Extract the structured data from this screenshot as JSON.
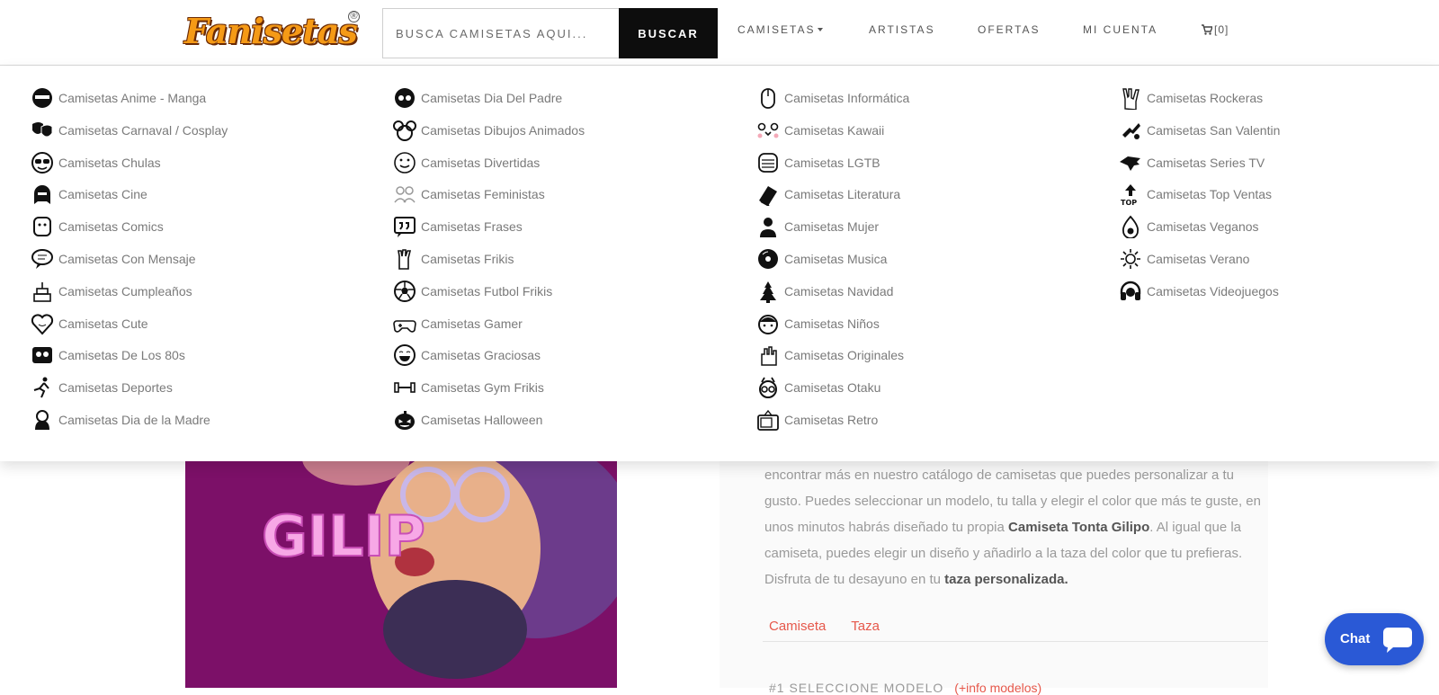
{
  "header": {
    "logo_text": "Fanisetas",
    "logo_mark": "®",
    "search_placeholder": "BUSCA CAMISETAS AQUI...",
    "search_button": "BUSCAR",
    "nav": [
      {
        "label": "CAMISETAS",
        "has_caret": true
      },
      {
        "label": "ARTISTAS"
      },
      {
        "label": "OFERTAS"
      },
      {
        "label": "MI CUENTA"
      }
    ],
    "cart_label": "[0]",
    "cart_icon": "cart-icon"
  },
  "menu": {
    "columns": [
      [
        {
          "label": "Camisetas Anime - Manga",
          "icon": "anime-icon"
        },
        {
          "label": "Camisetas Carnaval / Cosplay",
          "icon": "masks-icon"
        },
        {
          "label": "Camisetas Chulas",
          "icon": "sunglasses-face-icon"
        },
        {
          "label": "Camisetas Cine",
          "icon": "vader-icon"
        },
        {
          "label": "Camisetas Comics",
          "icon": "comic-face-icon"
        },
        {
          "label": "Camisetas Con Mensaje",
          "icon": "speech-bubble-icon"
        },
        {
          "label": "Camisetas Cumpleaños",
          "icon": "cake-icon"
        },
        {
          "label": "Camisetas Cute",
          "icon": "heart-face-icon"
        },
        {
          "label": "Camisetas De Los 80s",
          "icon": "cassette-icon"
        },
        {
          "label": "Camisetas Deportes",
          "icon": "runner-icon"
        },
        {
          "label": "Camisetas Dia de la Madre",
          "icon": "mother-icon"
        }
      ],
      [
        {
          "label": "Camisetas Dia Del Padre",
          "icon": "father-icon"
        },
        {
          "label": "Camisetas Dibujos Animados",
          "icon": "mouse-ears-icon"
        },
        {
          "label": "Camisetas Divertidas",
          "icon": "smiley-icon"
        },
        {
          "label": "Camisetas Feministas",
          "icon": "women-group-icon"
        },
        {
          "label": "Camisetas Frases",
          "icon": "quote-icon"
        },
        {
          "label": "Camisetas Frikis",
          "icon": "vulcan-hand-icon"
        },
        {
          "label": "Camisetas Futbol Frikis",
          "icon": "soccer-ball-icon"
        },
        {
          "label": "Camisetas Gamer",
          "icon": "gamepad-icon"
        },
        {
          "label": "Camisetas Graciosas",
          "icon": "laugh-icon"
        },
        {
          "label": "Camisetas Gym Frikis",
          "icon": "dumbbell-icon"
        },
        {
          "label": "Camisetas Halloween",
          "icon": "pumpkin-icon"
        }
      ],
      [
        {
          "label": "Camisetas Informática",
          "icon": "computer-mouse-icon"
        },
        {
          "label": "Camisetas Kawaii",
          "icon": "kawaii-face-icon"
        },
        {
          "label": "Camisetas LGTB",
          "icon": "rainbow-face-icon"
        },
        {
          "label": "Camisetas Literatura",
          "icon": "book-icon"
        },
        {
          "label": "Camisetas Mujer",
          "icon": "woman-icon"
        },
        {
          "label": "Camisetas Musica",
          "icon": "vinyl-icon"
        },
        {
          "label": "Camisetas Navidad",
          "icon": "christmas-tree-icon"
        },
        {
          "label": "Camisetas Niños",
          "icon": "child-face-icon"
        },
        {
          "label": "Camisetas Originales",
          "icon": "idea-hand-icon"
        },
        {
          "label": "Camisetas Otaku",
          "icon": "otaku-icon"
        },
        {
          "label": "Camisetas Retro",
          "icon": "tv-icon"
        }
      ],
      [
        {
          "label": "Camisetas Rockeras",
          "icon": "rock-hand-icon"
        },
        {
          "label": "Camisetas San Valentin",
          "icon": "cupid-icon"
        },
        {
          "label": "Camisetas Series TV",
          "icon": "wolf-icon"
        },
        {
          "label": "Camisetas Top Ventas",
          "icon": "top-icon"
        },
        {
          "label": "Camisetas Veganos",
          "icon": "avocado-icon"
        },
        {
          "label": "Camisetas Verano",
          "icon": "sun-icon"
        },
        {
          "label": "Camisetas Videojuegos",
          "icon": "headset-icon"
        }
      ]
    ]
  },
  "hero": {
    "art_text": "GILIP",
    "bg_color": "#7c1068"
  },
  "description": {
    "text_1": "encontrar más en nuestro catálogo de camisetas que puedes personalizar a tu gusto. Puedes seleccionar un modelo, tu talla y elegir el color que más te guste, en unos minutos habrás diseñado tu propia ",
    "bold_1": "Camiseta Tonta Gilipo",
    "text_2": ". Al igual que la camiseta, puedes elegir un diseño y añadirlo a la taza del color que tu prefieras. Disfruta de tu desayuno en tu ",
    "bold_2": "taza personalizada.",
    "tags": [
      "Camiseta",
      "Taza"
    ],
    "select_label": "#1 SELECCIONE MODELO",
    "select_link": "(+info modelos)"
  },
  "chat": {
    "label": "Chat",
    "color": "#2a59d6"
  },
  "colors": {
    "accent": "#e6584b",
    "logo_orange": "#f59a16",
    "button_bg": "#0d0d0d"
  }
}
